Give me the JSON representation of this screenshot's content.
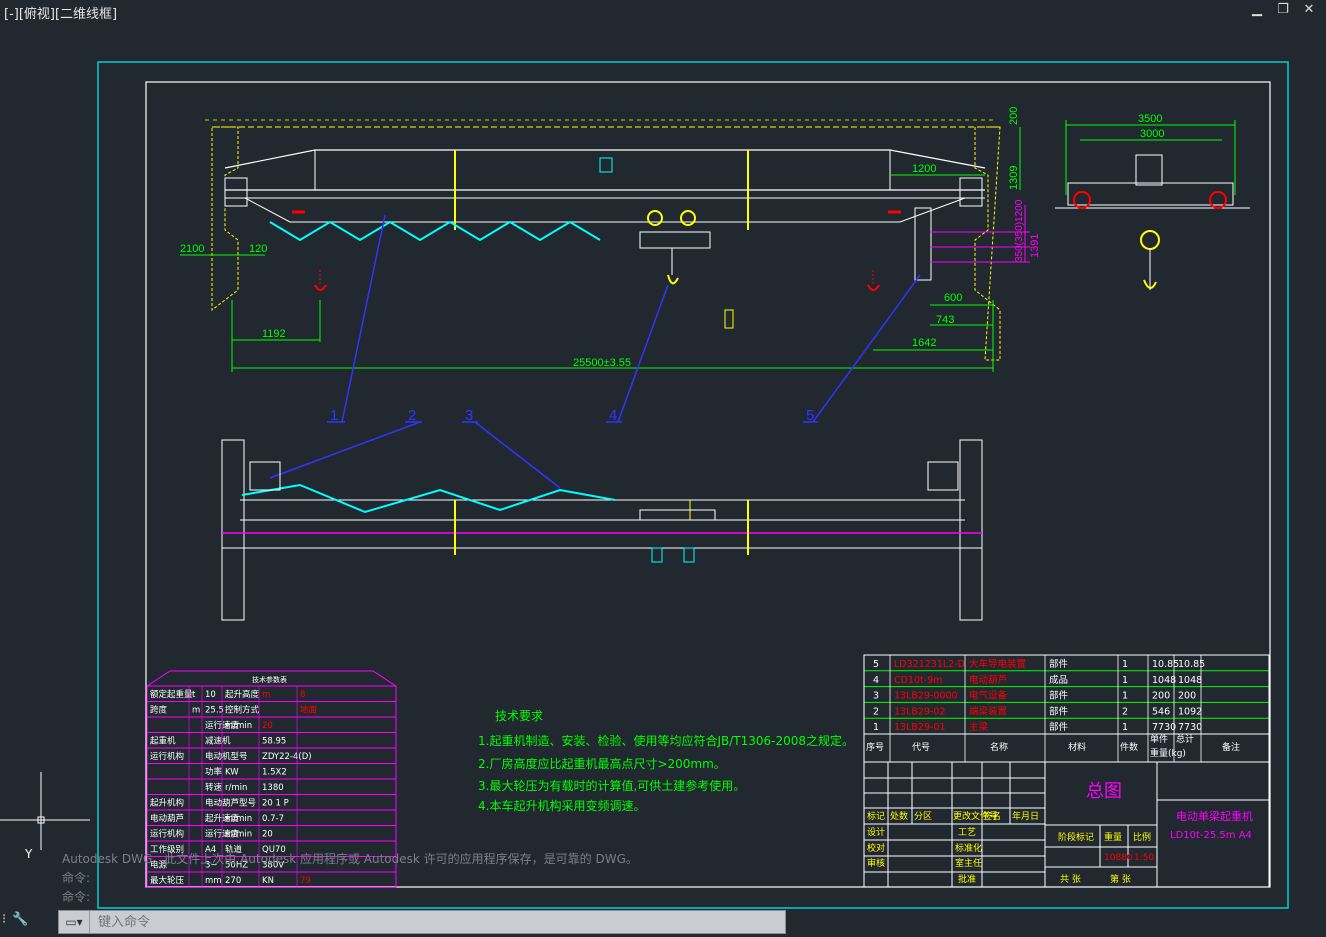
{
  "viewport": {
    "label": "[-][俯视][二维线框]"
  },
  "window_controls": {
    "minimize": "▁",
    "restore": "❐",
    "close": "✕"
  },
  "dims": {
    "d200": "200",
    "d1309": "1309",
    "d1200": "1200",
    "d2100": "2100",
    "d120": "120",
    "d1391": "1391",
    "d3505": "350(350)1200",
    "d600": "600",
    "d743": "743",
    "d1642": "1642",
    "d1192": "1192",
    "d25500": "25500±3.55",
    "d3500": "3500",
    "d3000": "3000"
  },
  "callouts": [
    "1",
    "2",
    "3",
    "4",
    "5"
  ],
  "tech_requirements": {
    "title": "技术要求",
    "items": [
      "1.起重机制造、安装、检验、使用等均应符合JB/T1306-2008之规定。",
      "2.厂房高度应比起重机最高点尺寸>200mm。",
      "3.最大轮压为有载时的计算值,可供土建参考使用。",
      "4.本车起升机构采用变频调速。"
    ]
  },
  "param_table": {
    "title": "技术参数表",
    "rows": [
      [
        "额定起重量",
        "t",
        "10",
        "起升高度",
        "m",
        "8"
      ],
      [
        "跨度",
        "m",
        "25.5",
        "控制方式",
        "",
        "地面"
      ],
      [
        "",
        "",
        "运行速度",
        "m/min",
        "20",
        ""
      ],
      [
        "起重机",
        "",
        "减速机",
        "",
        "58.95",
        ""
      ],
      [
        "运行机构",
        "",
        "电动机型号",
        "",
        "ZDY22-4(D)",
        ""
      ],
      [
        "",
        "",
        "功率",
        "KW",
        "1.5X2",
        ""
      ],
      [
        "",
        "",
        "转速",
        "r/min",
        "1380",
        ""
      ],
      [
        "起升机构",
        "",
        "电动葫芦型号",
        "",
        "20 1 P",
        ""
      ],
      [
        "电动葫芦",
        "",
        "起升速度",
        "m/min",
        "0.7-7",
        ""
      ],
      [
        "运行机构",
        "",
        "运行速度",
        "m/min",
        "20",
        ""
      ],
      [
        "工作级别",
        "",
        "A4",
        "轨道",
        "QU70",
        ""
      ],
      [
        "电源",
        "",
        "3~",
        "50HZ",
        "380V",
        ""
      ],
      [
        "最大轮压",
        "",
        "mm",
        "270",
        "KN",
        "79"
      ]
    ]
  },
  "parts_list": {
    "rows": [
      [
        "5",
        "LD321231L2-D",
        "大车导电装置",
        "部件",
        "1",
        "10.85",
        "10.85"
      ],
      [
        "4",
        "CD10t-9m",
        "电动葫芦",
        "成品",
        "1",
        "1048",
        "1048"
      ],
      [
        "3",
        "13LB29-0000",
        "电气设备",
        "部件",
        "1",
        "200",
        "200"
      ],
      [
        "2",
        "13LB29-02",
        "端梁装置",
        "部件",
        "2",
        "546",
        "1092"
      ],
      [
        "1",
        "13LB29-01",
        "主梁",
        "部件",
        "1",
        "7730",
        "7730"
      ]
    ],
    "headers": [
      "序号",
      "代号",
      "名称",
      "材料",
      "件数",
      "单件",
      "总计",
      "重量(kg)",
      "备注"
    ]
  },
  "title_block": {
    "drawing_title": "总图",
    "product": "电动单梁起重机",
    "model": "LD10t-25.5m A4",
    "labels": [
      "标记",
      "处数",
      "分区",
      "更改文件号",
      "签名",
      "年月日",
      "设计",
      "校对",
      "审核",
      "工艺",
      "标准化",
      "室主任",
      "批准",
      "阶段标记",
      "重量",
      "比例",
      "共 张",
      "第 张"
    ],
    "weight": "10880",
    "scale": "1:50"
  },
  "console": {
    "lines": [
      "Autodesk DWG。此文件上次由 Autodesk 应用程序或 Autodesk 许可的应用程序保存，是可靠的 DWG。",
      "命令:",
      "命令:"
    ]
  },
  "command": {
    "placeholder": "键入命令"
  },
  "colors": {
    "bg": "#212830",
    "green": "#00ff00",
    "magenta": "#ff00ff",
    "red": "#ff0000",
    "yellow": "#ffff00",
    "cyan": "#00ffff",
    "blue": "#3333ff",
    "frame": "#00d0d0"
  }
}
